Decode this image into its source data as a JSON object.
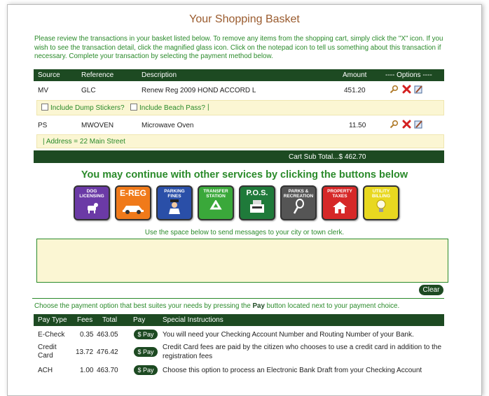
{
  "page_title": "Your Shopping Basket",
  "intro_text": "Please review the transactions in your basket listed below. To remove any items from the shopping cart, simply click the \"X\" icon. If you wish to see the transaction detail, click the magnified glass icon. Click on the notepad icon to tell us something about this transaction if necessary. Complete your transaction by selecting the payment method below.",
  "basket": {
    "headers": {
      "source": "Source",
      "reference": "Reference",
      "description": "Description",
      "amount": "Amount",
      "options": "---- Options ----"
    },
    "items": [
      {
        "source": "MV",
        "reference": "GLC",
        "description": "Renew Reg 2009 HOND ACCORD L",
        "amount": "451.20"
      },
      {
        "source": "PS",
        "reference": "MWOVEN",
        "description": "Microwave Oven",
        "amount": "11.50"
      }
    ],
    "checkbox_dump": "Include Dump Stickers?",
    "checkbox_beach": "Include Beach Pass?",
    "divider": "|",
    "address_text": "| Address = 22 Main Street",
    "subtotal": "Cart Sub Total...$ 462.70"
  },
  "services": {
    "heading": "You may continue with other services by clicking the buttons below",
    "buttons": [
      {
        "label": "Dog Licensing",
        "color": "#6b3aa6",
        "icon": "dog-icon"
      },
      {
        "label": "E-Reg",
        "color": "#f07a1a",
        "icon": "car-icon"
      },
      {
        "label": "Parking Fines",
        "color": "#2a4fa8",
        "icon": "officer-icon"
      },
      {
        "label": "Transfer Station",
        "color": "#3aa83a",
        "icon": "recycle-icon"
      },
      {
        "label": "P.O.S.",
        "color": "#1f7a3a",
        "icon": "register-icon"
      },
      {
        "label": "Parks & Recreation",
        "color": "#555555",
        "icon": "racket-icon"
      },
      {
        "label": "Property Taxes",
        "color": "#d62828",
        "icon": "house-icon"
      },
      {
        "label": "Utility Billing",
        "color": "#e8d820",
        "icon": "bulb-icon"
      }
    ]
  },
  "message": {
    "instructions": "Use the space below to send messages to your city or town clerk.",
    "value": "",
    "clear_label": "Clear"
  },
  "payment": {
    "instructions_pre": "Choose the payment option that best suites your needs by pressing the ",
    "instructions_bold": "Pay",
    "instructions_post": " button located next to your payment choice.",
    "headers": {
      "type": "Pay Type",
      "fees": "Fees",
      "total": "Total",
      "pay": "Pay",
      "special": "Special Instructions"
    },
    "pay_label": "$ Pay",
    "options": [
      {
        "type": "E-Check",
        "fees": "0.35",
        "total": "463.05",
        "special": "You will need your Checking Account Number and Routing Number of your Bank."
      },
      {
        "type": "Credit Card",
        "fees": "13.72",
        "total": "476.42",
        "special": "Credit Card fees are paid by the citizen who chooses to use a credit card in addition to the registration fees"
      },
      {
        "type": "ACH",
        "fees": "1.00",
        "total": "463.70",
        "special": "Choose this option to process an Electronic Bank Draft from your Checking Account"
      }
    ]
  }
}
